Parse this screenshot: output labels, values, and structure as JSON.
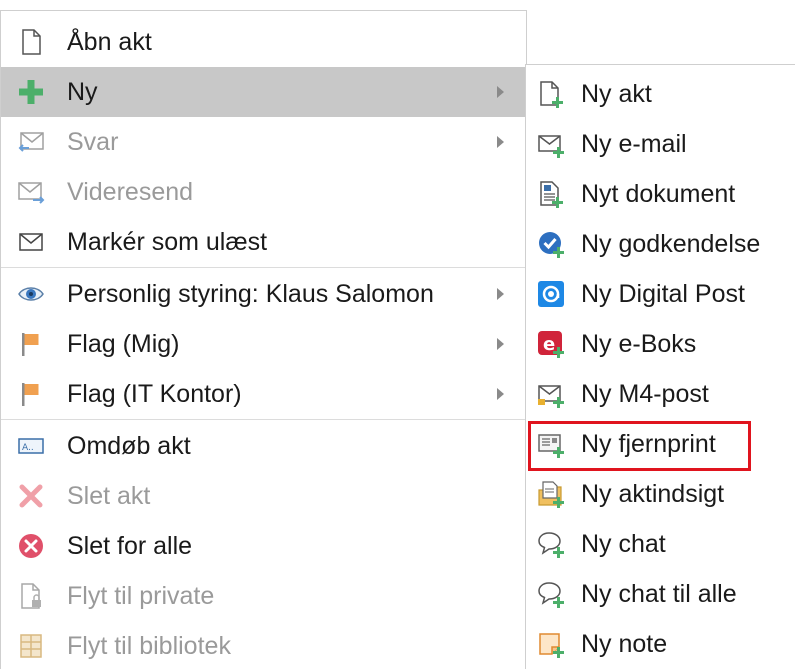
{
  "main_menu": {
    "items": [
      {
        "label": "Åbn akt",
        "icon": "document-icon",
        "disabled": false
      },
      {
        "label": "Ny",
        "icon": "plus-icon",
        "disabled": false,
        "submenu": true,
        "hovered": true
      },
      {
        "label": "Svar",
        "icon": "reply-envelope-icon",
        "disabled": true,
        "submenu": true
      },
      {
        "label": "Videresend",
        "icon": "forward-envelope-icon",
        "disabled": true
      },
      {
        "label": "Markér som ulæst",
        "icon": "envelope-icon",
        "disabled": false
      },
      {
        "label": "Personlig styring: Klaus Salomon",
        "icon": "eye-icon",
        "disabled": false,
        "submenu": true
      },
      {
        "label": "Flag (Mig)",
        "icon": "flag-icon",
        "disabled": false,
        "submenu": true
      },
      {
        "label": "Flag (IT Kontor)",
        "icon": "flag-icon",
        "disabled": false,
        "submenu": true
      },
      {
        "label": "Omdøb akt",
        "icon": "rename-icon",
        "disabled": false
      },
      {
        "label": "Slet akt",
        "icon": "delete-x-icon",
        "disabled": true
      },
      {
        "label": "Slet for alle",
        "icon": "delete-circle-icon",
        "disabled": false
      },
      {
        "label": "Flyt til private",
        "icon": "lock-document-icon",
        "disabled": true
      },
      {
        "label": "Flyt til bibliotek",
        "icon": "library-icon",
        "disabled": true
      }
    ]
  },
  "sub_menu": {
    "items": [
      {
        "label": "Ny akt",
        "icon": "new-document-icon"
      },
      {
        "label": "Ny e-mail",
        "icon": "new-email-icon"
      },
      {
        "label": "Nyt dokument",
        "icon": "word-document-icon"
      },
      {
        "label": "Ny godkendelse",
        "icon": "approval-check-icon"
      },
      {
        "label": "Ny Digital Post",
        "icon": "digital-post-at-icon"
      },
      {
        "label": "Ny e-Boks",
        "icon": "eboks-icon"
      },
      {
        "label": "Ny M4-post",
        "icon": "m4-post-icon"
      },
      {
        "label": "Ny fjernprint",
        "icon": "remote-print-icon",
        "highlighted": true
      },
      {
        "label": "Ny aktindsigt",
        "icon": "file-access-icon"
      },
      {
        "label": "Ny chat",
        "icon": "chat-icon"
      },
      {
        "label": "Ny chat til alle",
        "icon": "chat-all-icon"
      },
      {
        "label": "Ny note",
        "icon": "note-icon"
      }
    ]
  },
  "colors": {
    "hover_bg": "#c8c8c8",
    "highlight_border": "#e0141e",
    "plus_green": "#4caf6a",
    "flag_orange": "#f0a050",
    "check_blue": "#2d6fc0",
    "eboks_red": "#d0243a",
    "delete_red": "#e0506a"
  }
}
